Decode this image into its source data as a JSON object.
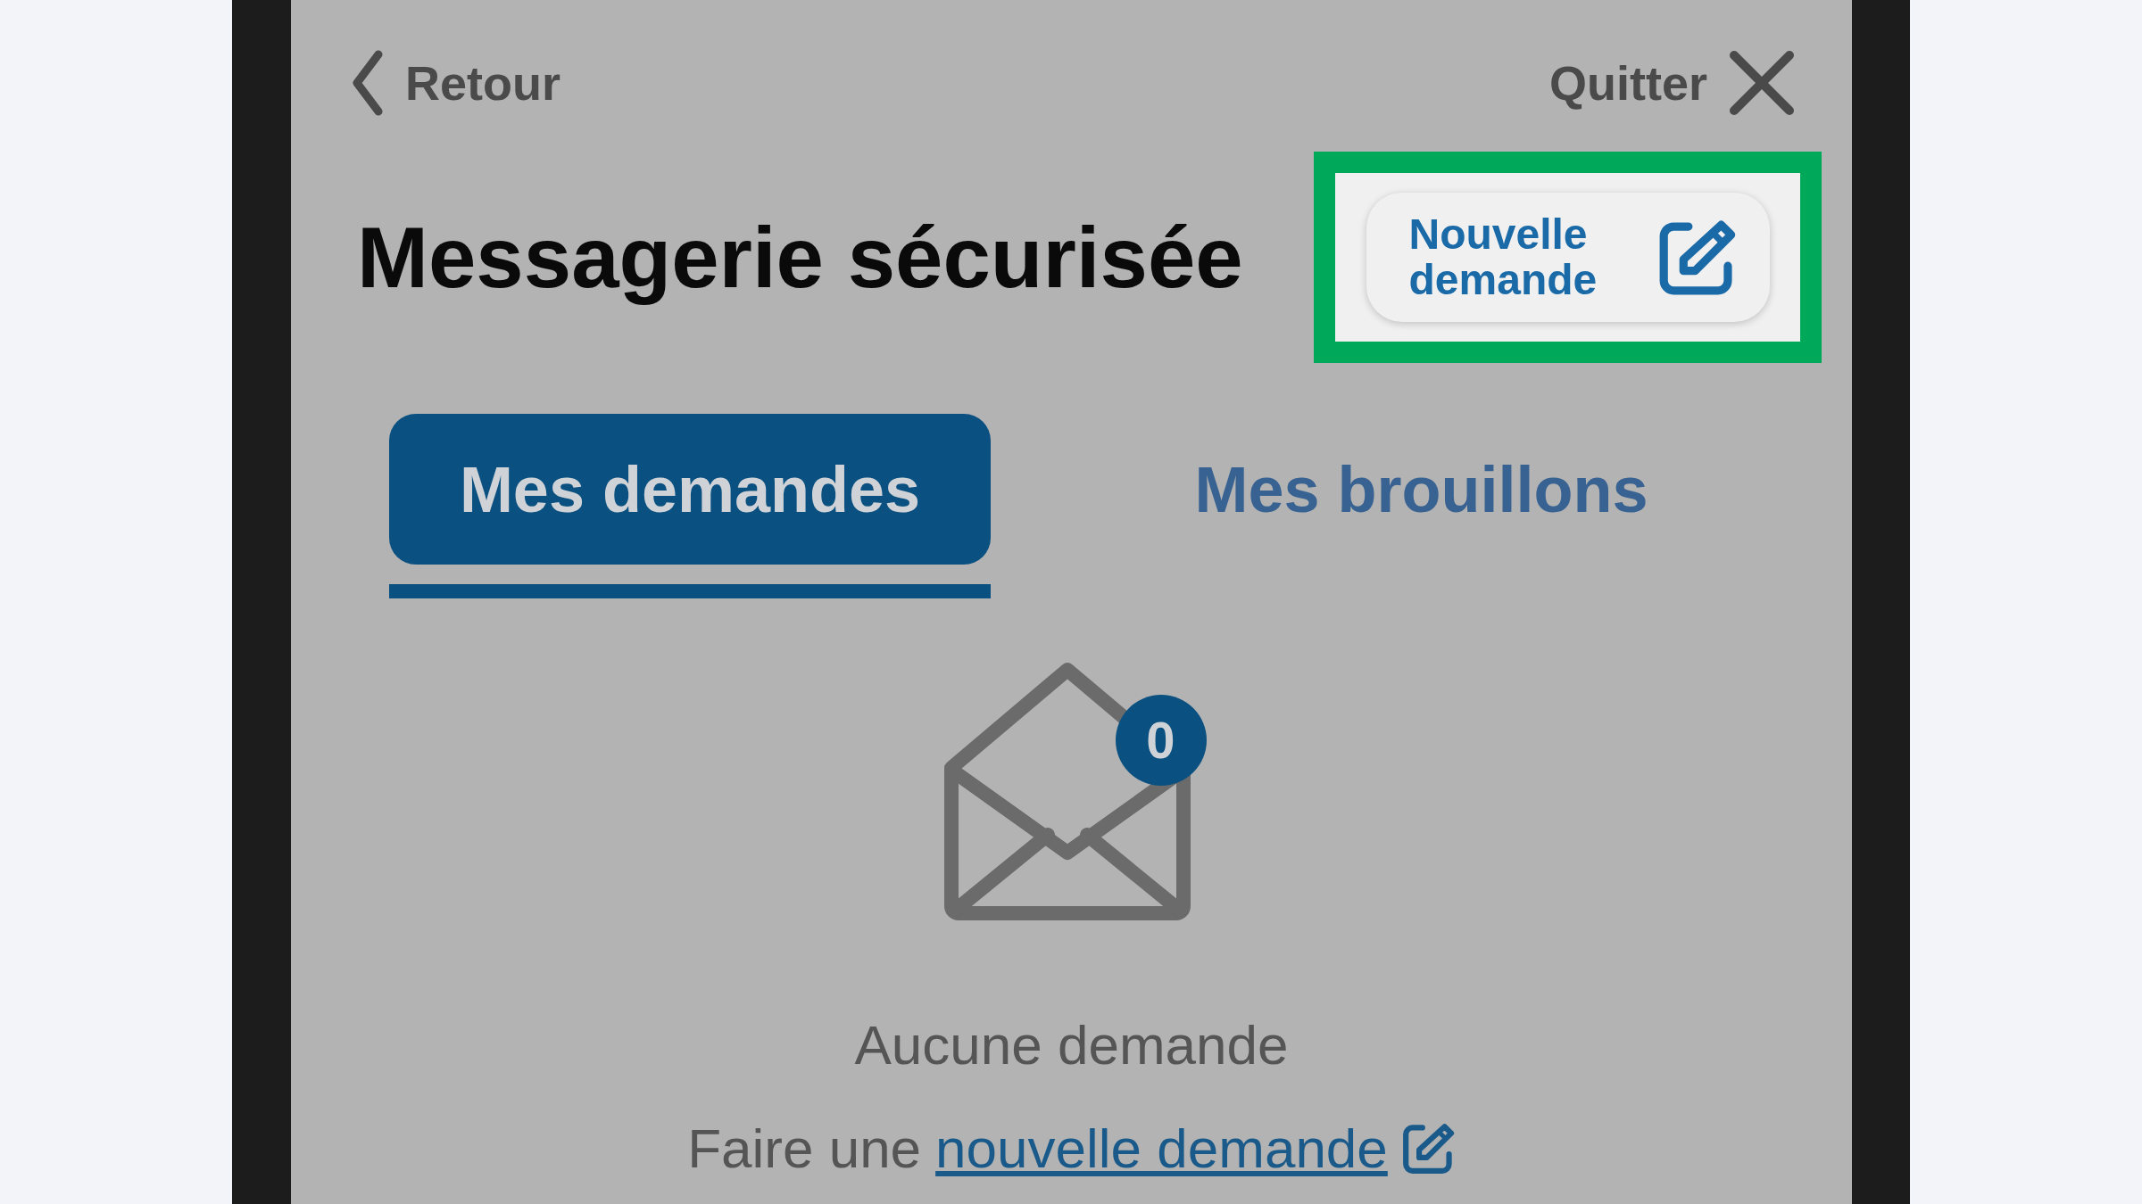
{
  "nav": {
    "back": "Retour",
    "quit": "Quitter"
  },
  "title": "Messagerie sécurisée",
  "new_request_button": {
    "label": "Nouvelle demande",
    "highlighted": true
  },
  "tabs": [
    {
      "label": "Mes demandes",
      "selected": true
    },
    {
      "label": "Mes brouillons",
      "selected": false
    }
  ],
  "empty_state": {
    "count": "0",
    "message": "Aucune demande",
    "prompt": "Faire une",
    "link": "nouvelle demande"
  }
}
